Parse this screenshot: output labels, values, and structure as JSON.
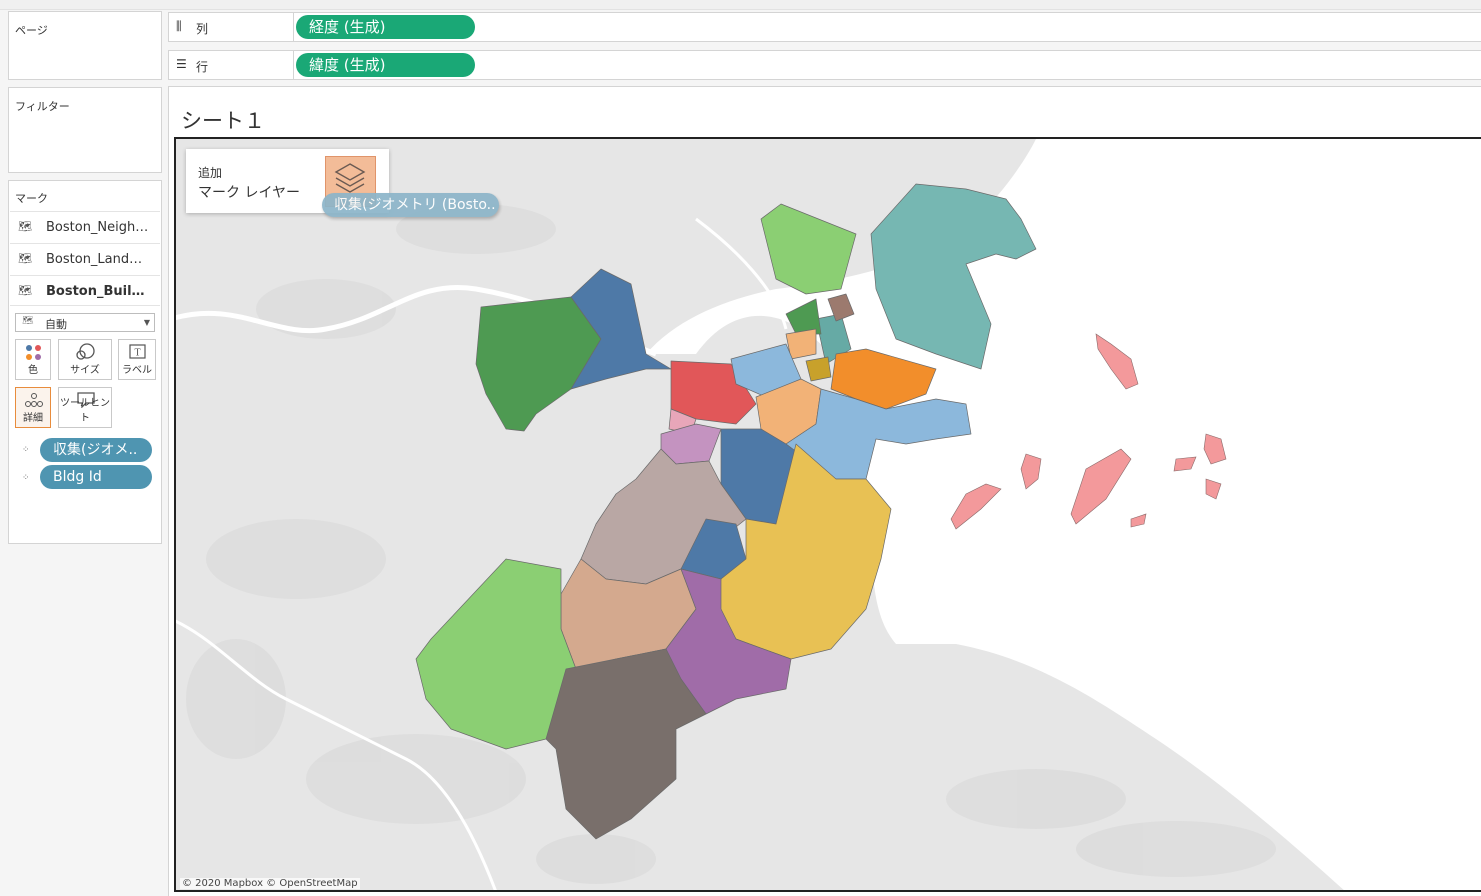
{
  "pages_card": {
    "title": "ページ"
  },
  "filters_card": {
    "title": "フィルター"
  },
  "marks_card": {
    "title": "マーク",
    "layers": [
      {
        "label": "Boston_Neigh…",
        "icon": "map-layer-icon"
      },
      {
        "label": "Boston_Land…",
        "icon": "map-layer-icon"
      },
      {
        "label": "Boston_Buil…",
        "icon": "map-layer-icon",
        "active": true
      }
    ],
    "mark_type": "自動",
    "buttons": {
      "color": "色",
      "size": "サイズ",
      "label": "ラベル",
      "detail": "詳細",
      "tooltip": "ツールヒント"
    },
    "fields": [
      {
        "label": "収集(ジオメ.."
      },
      {
        "label": "Bldg Id"
      }
    ]
  },
  "shelves": {
    "columns": {
      "label": "列",
      "pill": "経度 (生成)"
    },
    "rows": {
      "label": "行",
      "pill": "緯度 (生成)"
    }
  },
  "sheet": {
    "title": "シート１"
  },
  "map": {
    "legend_line1": "追加",
    "legend_line2": "マーク レイヤー",
    "drag_pill": "収集(ジオメトリ (Bosto..",
    "attribution": "© 2020 Mapbox © OpenStreetMap",
    "colors": {
      "green_dark": "#4e9a52",
      "blue_dark": "#4e79a7",
      "red": "#e15759",
      "pink_light": "#e8a6b9",
      "purple_light": "#c493c0",
      "light_blue": "#8cb8dc",
      "orange_light": "#f2b277",
      "orange": "#f28e2b",
      "teal": "#76b7b2",
      "brown_light": "#b9a7a4",
      "tan": "#d4a98e",
      "gray_dark": "#796f6b",
      "purple": "#a06ca8",
      "green_light": "#8bcf73",
      "yellow": "#e8c154",
      "teal_dark": "#66aaa5",
      "brown": "#9c7a6e",
      "salmon": "#f3999b"
    }
  }
}
